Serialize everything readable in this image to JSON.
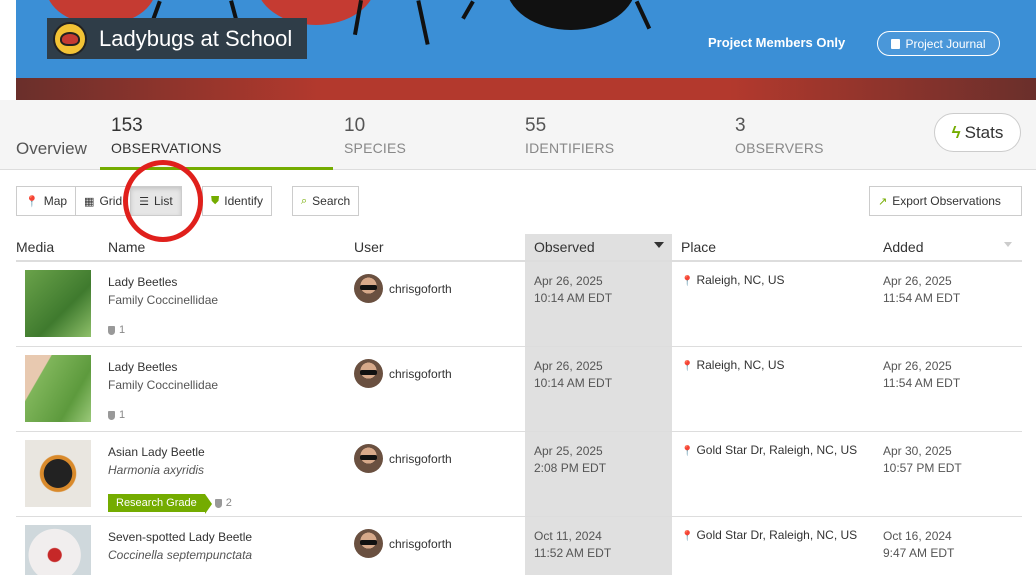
{
  "header": {
    "title": "Ladybugs at School",
    "members_only": "Project Members Only",
    "journal_button": "Project Journal"
  },
  "tabs": {
    "overview": "Overview",
    "observations": {
      "count": "153",
      "label": "OBSERVATIONS"
    },
    "species": {
      "count": "10",
      "label": "SPECIES"
    },
    "identifiers": {
      "count": "55",
      "label": "IDENTIFIERS"
    },
    "observers": {
      "count": "3",
      "label": "OBSERVERS"
    },
    "stats_button": "Stats"
  },
  "views": {
    "map": "Map",
    "grid": "Grid",
    "list": "List",
    "identify": "Identify",
    "search": "Search",
    "export": "Export Observations",
    "active_view": "list"
  },
  "table": {
    "columns": [
      "Media",
      "Name",
      "User",
      "Observed",
      "Place",
      "Added"
    ],
    "rows": [
      {
        "common": "Lady Beetles",
        "scientific": "Family Coccinellidae",
        "italic": false,
        "research_grade": "",
        "ids": "1",
        "user": "chrisgoforth",
        "obs_date": "Apr 26, 2025",
        "obs_time": "10:14 AM EDT",
        "place": "Raleigh, NC, US",
        "added_date": "Apr 26, 2025",
        "added_time": "11:54 AM EDT"
      },
      {
        "common": "Lady Beetles",
        "scientific": "Family Coccinellidae",
        "italic": false,
        "research_grade": "",
        "ids": "1",
        "user": "chrisgoforth",
        "obs_date": "Apr 26, 2025",
        "obs_time": "10:14 AM EDT",
        "place": "Raleigh, NC, US",
        "added_date": "Apr 26, 2025",
        "added_time": "11:54 AM EDT"
      },
      {
        "common": "Asian Lady Beetle",
        "scientific": "Harmonia axyridis",
        "italic": true,
        "research_grade": "Research Grade",
        "ids": "2",
        "user": "chrisgoforth",
        "obs_date": "Apr 25, 2025",
        "obs_time": "2:08 PM EDT",
        "place": "Gold Star Dr, Raleigh, NC, US",
        "added_date": "Apr 30, 2025",
        "added_time": "10:57 PM EDT"
      },
      {
        "common": "Seven-spotted Lady Beetle",
        "scientific": "Coccinella septempunctata",
        "italic": true,
        "research_grade": "",
        "ids": "",
        "user": "chrisgoforth",
        "obs_date": "Oct 11, 2024",
        "obs_time": "11:52 AM EDT",
        "place": "Gold Star Dr, Raleigh, NC, US",
        "added_date": "Oct 16, 2024",
        "added_time": "9:47 AM EDT"
      }
    ]
  },
  "colors": {
    "accent_green": "#74ac00",
    "banner_blue": "#3b8fd6",
    "highlight_circle": "#e0201c"
  }
}
